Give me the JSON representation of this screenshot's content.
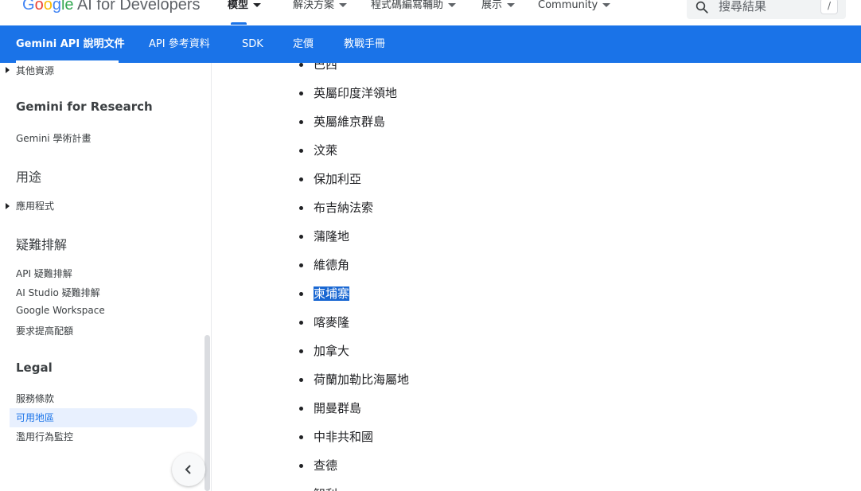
{
  "header": {
    "logo": {
      "g1": "G",
      "g2": "o",
      "g3": "o",
      "g4": "g",
      "g5": "le",
      "rest": " AI for Developers"
    },
    "nav": [
      {
        "label": "模型",
        "active": true
      },
      {
        "label": "解決方案",
        "active": false
      },
      {
        "label": "程式碼編寫輔助",
        "active": false
      },
      {
        "label": "展示",
        "active": false
      },
      {
        "label": "Community",
        "active": false
      }
    ],
    "search": {
      "placeholder": "搜尋結果",
      "shortcut": "/"
    }
  },
  "subnav": {
    "tabs": [
      {
        "label": "Gemini API 說明文件",
        "active": true
      },
      {
        "label": "API 參考資料",
        "active": false
      },
      {
        "label": "SDK",
        "active": false
      },
      {
        "label": "定價",
        "active": false
      },
      {
        "label": "教戰手冊",
        "active": false
      }
    ],
    "accent": "#1a73e8"
  },
  "sidebar": {
    "other_resources": "其他資源",
    "research_heading": "Gemini for Research",
    "research_item": "Gemini 學術計畫",
    "uses_heading": "用途",
    "apps_item": "應用程式",
    "troubleshoot_heading": "疑難排解",
    "troubleshoot_items": [
      "API 疑難排解",
      "AI Studio 疑難排解",
      "Google Workspace",
      "要求提高配額"
    ],
    "legal_heading": "Legal",
    "legal_items": [
      "服務條款",
      "可用地區",
      "濫用行為監控"
    ],
    "selected_item": "可用地區",
    "selected_bg": "#e8f0fe"
  },
  "content": {
    "countries": [
      "巴西",
      "英屬印度洋領地",
      "英屬維京群島",
      "汶萊",
      "保加利亞",
      "布吉納法索",
      "蒲隆地",
      "維德角",
      "柬埔寨",
      "喀麥隆",
      "加拿大",
      "荷蘭加勒比海屬地",
      "開曼群島",
      "中非共和國",
      "查德",
      "智利"
    ],
    "highlighted": "柬埔寨",
    "highlight_color": "#1967d2"
  }
}
